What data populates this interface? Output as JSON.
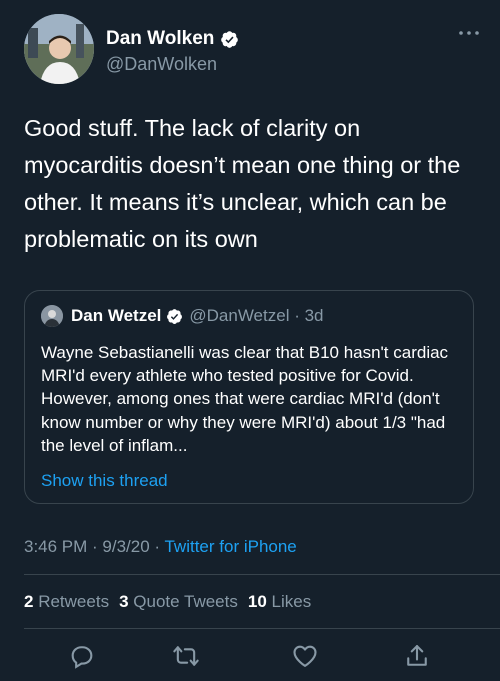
{
  "tweet": {
    "author": {
      "display_name": "Dan Wolken",
      "handle": "@DanWolken",
      "verified": true
    },
    "text": "Good stuff. The lack of clarity on myocarditis doesn’t mean one thing or the other. It means it’s unclear, which can be problematic on its own",
    "quoted": {
      "display_name": "Dan Wetzel",
      "handle_time": "@DanWetzel · 3d",
      "text": "Wayne Sebastianelli was clear that B10 hasn't cardiac MRI'd every athlete who tested positive for Covid. However, among ones that were cardiac MRI'd (don't know number or why they were MRI'd) about 1/3 \"had the level of inflam...",
      "show_thread": "Show this thread"
    },
    "meta": {
      "time": "3:46 PM · 9/3/20 · ",
      "source": "Twitter for iPhone"
    },
    "stats": {
      "retweets_count": "2",
      "retweets_label": "Retweets",
      "quote_count": "3",
      "quote_label": "Quote Tweets",
      "likes_count": "10",
      "likes_label": "Likes"
    }
  },
  "colors": {
    "background": "#15202b",
    "secondary_text": "#8899a6",
    "accent": "#1da1f2",
    "border": "#38444d"
  },
  "icons": [
    "more-icon",
    "verified-icon",
    "reply-icon",
    "retweet-icon",
    "like-icon",
    "share-icon"
  ]
}
